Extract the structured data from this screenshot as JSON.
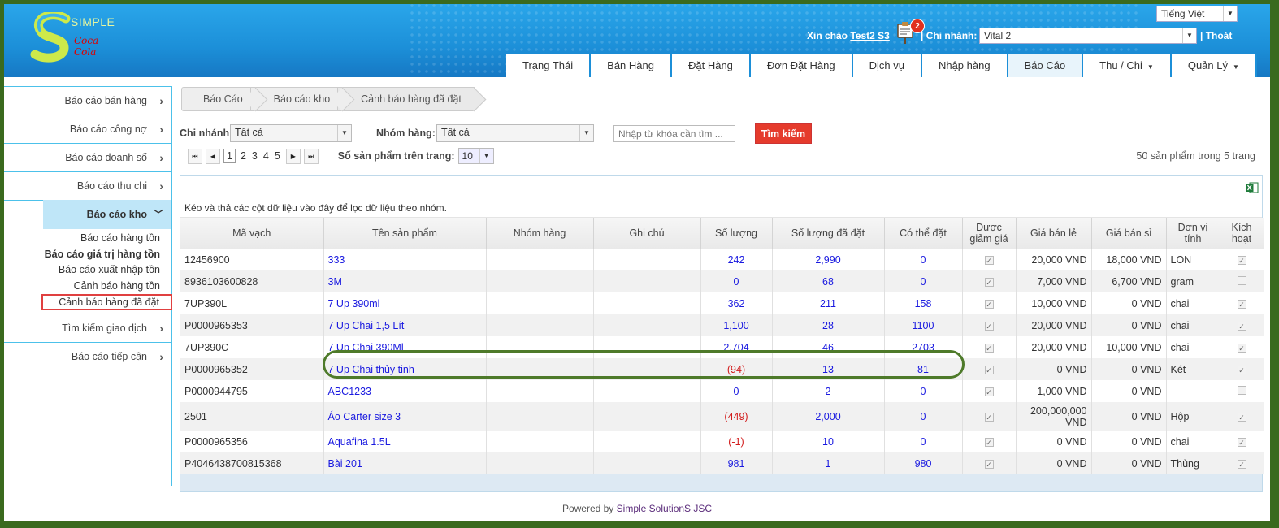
{
  "header": {
    "logo_text": "SIMPLE",
    "logo_partner": "Coca-Cola",
    "language": "Tiếng Việt",
    "greeting": "Xin chào",
    "username": "Test2 S3",
    "notification_count": "2",
    "separator": "|",
    "branch_label": "Chi nhánh:",
    "branch_value": "Vital 2",
    "logout": "| Thoát"
  },
  "nav": {
    "tabs": [
      {
        "label": "Trạng Thái"
      },
      {
        "label": "Bán Hàng"
      },
      {
        "label": "Đặt Hàng"
      },
      {
        "label": "Đơn Đặt Hàng"
      },
      {
        "label": "Dịch vụ"
      },
      {
        "label": "Nhập hàng"
      },
      {
        "label": "Báo Cáo"
      },
      {
        "label": "Thu / Chi"
      },
      {
        "label": "Quản Lý"
      }
    ],
    "active": "Báo Cáo"
  },
  "sidebar": {
    "items": [
      {
        "label": "Báo cáo bán hàng"
      },
      {
        "label": "Báo cáo công nợ"
      },
      {
        "label": "Báo cáo doanh số"
      },
      {
        "label": "Báo cáo thu chi"
      }
    ],
    "open_section": "Báo cáo kho",
    "sub_items": [
      {
        "label": "Báo cáo hàng tồn"
      },
      {
        "label": "Báo cáo giá trị hàng tồn"
      },
      {
        "label": "Báo cáo xuất nhập tồn"
      },
      {
        "label": "Cảnh báo hàng tồn"
      },
      {
        "label": "Cảnh báo hàng đã đặt"
      }
    ],
    "items_after": [
      {
        "label": "Tìm kiếm giao dịch"
      },
      {
        "label": "Báo cáo tiếp cận"
      }
    ]
  },
  "breadcrumb": [
    "Báo Cáo",
    "Báo cáo kho",
    "Cảnh báo hàng đã đặt"
  ],
  "filters": {
    "branch_label": "Chi nhánh",
    "branch_value": "Tất cả",
    "group_label": "Nhóm hàng:",
    "group_value": "Tất cả",
    "keyword_placeholder": "Nhập từ khóa cần tìm ...",
    "search_button": "Tìm kiếm"
  },
  "pager": {
    "pages": [
      "1",
      "2",
      "3",
      "4",
      "5"
    ],
    "current": "1",
    "page_size_label": "Số sản phẩm trên trang:",
    "page_size": "10",
    "summary": "50 sản phẩm trong 5 trang"
  },
  "grid": {
    "group_hint": "Kéo và thả các cột dữ liệu vào đây để lọc dữ liệu theo nhóm.",
    "columns": [
      "Mã vạch",
      "Tên sản phẩm",
      "Nhóm hàng",
      "Ghi chú",
      "Số lượng",
      "Số lượng đã đặt",
      "Có thể đặt",
      "Được giảm giá",
      "Giá bán lẻ",
      "Giá bán sỉ",
      "Đơn vị tính",
      "Kích hoạt"
    ],
    "rows": [
      {
        "barcode": "12456900",
        "name": "333",
        "group": "",
        "note": "",
        "qty": "242",
        "ordered": "2,990",
        "available": "0",
        "discount": true,
        "retail": "20,000 VND",
        "wholesale": "18,000 VND",
        "unit": "LON",
        "active": true
      },
      {
        "barcode": "8936103600828",
        "name": "3M",
        "group": "",
        "note": "",
        "qty": "0",
        "ordered": "68",
        "available": "0",
        "discount": true,
        "retail": "7,000 VND",
        "wholesale": "6,700 VND",
        "unit": "gram",
        "active": false
      },
      {
        "barcode": "7UP390L",
        "name": "7 Up 390ml",
        "group": "",
        "note": "",
        "qty": "362",
        "ordered": "211",
        "available": "158",
        "discount": true,
        "retail": "10,000 VND",
        "wholesale": "0 VND",
        "unit": "chai",
        "active": true
      },
      {
        "barcode": "P0000965353",
        "name": "7 Up Chai 1,5 Lít",
        "group": "",
        "note": "",
        "qty": "1,100",
        "ordered": "28",
        "available": "1100",
        "discount": true,
        "retail": "20,000 VND",
        "wholesale": "0 VND",
        "unit": "chai",
        "active": true
      },
      {
        "barcode": "7UP390C",
        "name": "7 Up Chai 390Ml",
        "group": "",
        "note": "",
        "qty": "2,704",
        "ordered": "46",
        "available": "2703",
        "discount": true,
        "retail": "20,000 VND",
        "wholesale": "10,000 VND",
        "unit": "chai",
        "active": true
      },
      {
        "barcode": "P0000965352",
        "name": "7 Up Chai thủy tinh",
        "group": "",
        "note": "",
        "qty": "(94)",
        "ordered": "13",
        "available": "81",
        "discount": true,
        "retail": "0 VND",
        "wholesale": "0 VND",
        "unit": "Két",
        "active": true
      },
      {
        "barcode": "P0000944795",
        "name": "ABC1233",
        "group": "",
        "note": "",
        "qty": "0",
        "ordered": "2",
        "available": "0",
        "discount": true,
        "retail": "1,000 VND",
        "wholesale": "0 VND",
        "unit": "",
        "active": false
      },
      {
        "barcode": "2501",
        "name": "Áo Carter size 3",
        "group": "",
        "note": "",
        "qty": "(449)",
        "ordered": "2,000",
        "available": "0",
        "discount": true,
        "retail": "200,000,000 VND",
        "wholesale": "0 VND",
        "unit": "Hộp",
        "active": true
      },
      {
        "barcode": "P0000965356",
        "name": "Aquafina 1.5L",
        "group": "",
        "note": "",
        "qty": "(-1)",
        "ordered": "10",
        "available": "0",
        "discount": true,
        "retail": "0 VND",
        "wholesale": "0 VND",
        "unit": "chai",
        "active": true
      },
      {
        "barcode": "P4046438700815368",
        "name": "Bài 201",
        "group": "",
        "note": "",
        "qty": "981",
        "ordered": "1",
        "available": "980",
        "discount": true,
        "retail": "0 VND",
        "wholesale": "0 VND",
        "unit": "Thùng",
        "active": true
      }
    ]
  },
  "footer": {
    "prefix": "Powered by",
    "company": "Simple SolutionS JSC"
  },
  "colors": {
    "header_blue": "#1c8fd8",
    "search_button": "#e53b2c",
    "link_blue": "#1a1ae0",
    "negative_red": "#d21c1c",
    "highlight_box": "#e04040",
    "highlight_oval": "#4e7a2a"
  }
}
